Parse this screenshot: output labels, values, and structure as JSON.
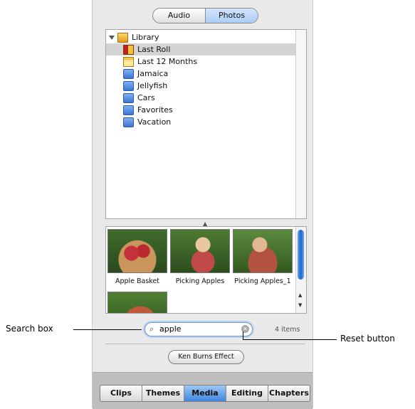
{
  "media_toggle": {
    "audio": "Audio",
    "photos": "Photos",
    "selected": "Photos"
  },
  "library": {
    "root": "Library",
    "items": [
      {
        "label": "Last Roll",
        "icon": "film-roll-icon",
        "selected": true
      },
      {
        "label": "Last 12 Months",
        "icon": "calendar-icon",
        "selected": false
      },
      {
        "label": "Jamaica",
        "icon": "album-icon",
        "selected": false
      },
      {
        "label": "Jellyfish",
        "icon": "album-icon",
        "selected": false
      },
      {
        "label": "Cars",
        "icon": "album-icon",
        "selected": false
      },
      {
        "label": "Favorites",
        "icon": "album-icon",
        "selected": false
      },
      {
        "label": "Vacation",
        "icon": "album-icon",
        "selected": false
      }
    ]
  },
  "photos": [
    {
      "caption": "Apple Basket"
    },
    {
      "caption": "Picking Apples"
    },
    {
      "caption": "Picking Apples_1"
    },
    {
      "caption": ""
    }
  ],
  "search": {
    "value": "apple",
    "count": "4 items"
  },
  "ken_burns_button": "Ken Burns Effect",
  "tabs": [
    {
      "label": "Clips"
    },
    {
      "label": "Themes"
    },
    {
      "label": "Media",
      "active": true
    },
    {
      "label": "Editing"
    },
    {
      "label": "Chapters"
    }
  ],
  "callouts": {
    "search_box": "Search box",
    "reset_button": "Reset button"
  },
  "colors": {
    "accent": "#3d86de",
    "selection": "#d4d4d4"
  }
}
